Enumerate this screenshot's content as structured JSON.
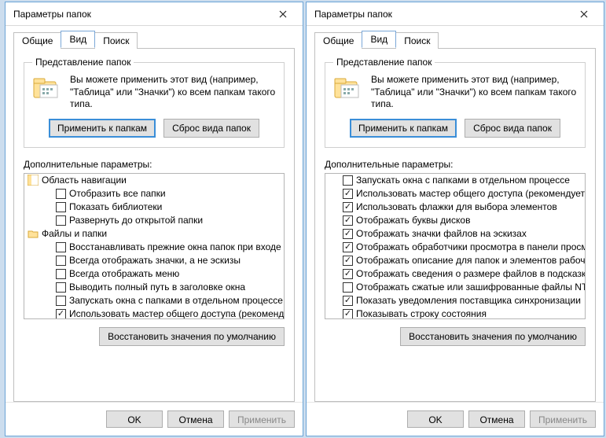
{
  "title": "Параметры папок",
  "tabs": {
    "general": "Общие",
    "view": "Вид",
    "search": "Поиск"
  },
  "groupbox": {
    "title": "Представление папок",
    "desc": "Вы можете применить этот вид (например, \"Таблица\" или \"Значки\") ко всем папкам такого типа.",
    "apply_btn": "Применить к папкам",
    "reset_btn": "Сброс вида папок"
  },
  "adv_label": "Дополнительные параметры:",
  "restore_defaults": "Восстановить значения по умолчанию",
  "buttons": {
    "ok": "OK",
    "cancel": "Отмена",
    "apply": "Применить"
  },
  "left_tree": [
    {
      "type": "cat",
      "icon": "nav",
      "label": "Область навигации"
    },
    {
      "type": "chk",
      "lvl": 1,
      "checked": false,
      "label": "Отобразить все папки"
    },
    {
      "type": "chk",
      "lvl": 1,
      "checked": false,
      "label": "Показать библиотеки"
    },
    {
      "type": "chk",
      "lvl": 1,
      "checked": false,
      "label": "Развернуть до открытой папки"
    },
    {
      "type": "cat",
      "icon": "folder",
      "label": "Файлы и папки"
    },
    {
      "type": "chk",
      "lvl": 1,
      "checked": false,
      "label": "Восстанавливать прежние окна папок при входе в си"
    },
    {
      "type": "chk",
      "lvl": 1,
      "checked": false,
      "label": "Всегда отображать значки, а не эскизы"
    },
    {
      "type": "chk",
      "lvl": 1,
      "checked": false,
      "label": "Всегда отображать меню"
    },
    {
      "type": "chk",
      "lvl": 1,
      "checked": false,
      "label": "Выводить полный путь в заголовке окна"
    },
    {
      "type": "chk",
      "lvl": 1,
      "checked": false,
      "label": "Запускать окна с папками в отдельном процессе"
    },
    {
      "type": "chk",
      "lvl": 1,
      "checked": true,
      "label": "Использовать мастер общего доступа (рекомендует"
    }
  ],
  "right_tree": [
    {
      "type": "chk",
      "lvl": 0,
      "checked": false,
      "label": "Запускать окна с папками в отдельном процессе"
    },
    {
      "type": "chk",
      "lvl": 0,
      "checked": true,
      "label": "Использовать мастер общего доступа (рекомендует"
    },
    {
      "type": "chk",
      "lvl": 0,
      "checked": true,
      "label": "Использовать флажки для выбора элементов"
    },
    {
      "type": "chk",
      "lvl": 0,
      "checked": true,
      "label": "Отображать буквы дисков"
    },
    {
      "type": "chk",
      "lvl": 0,
      "checked": true,
      "label": "Отображать значки файлов на эскизах"
    },
    {
      "type": "chk",
      "lvl": 0,
      "checked": true,
      "label": "Отображать обработчики просмотра в панели просм"
    },
    {
      "type": "chk",
      "lvl": 0,
      "checked": true,
      "label": "Отображать описание для папок и элементов рабоче"
    },
    {
      "type": "chk",
      "lvl": 0,
      "checked": true,
      "label": "Отображать сведения о размере файлов в подсказк"
    },
    {
      "type": "chk",
      "lvl": 0,
      "checked": false,
      "label": "Отображать сжатые или зашифрованные файлы NTI"
    },
    {
      "type": "chk",
      "lvl": 0,
      "checked": true,
      "label": "Показать уведомления поставщика синхронизации"
    },
    {
      "type": "chk",
      "lvl": 0,
      "checked": true,
      "label": "Показывать строку состояния"
    }
  ]
}
